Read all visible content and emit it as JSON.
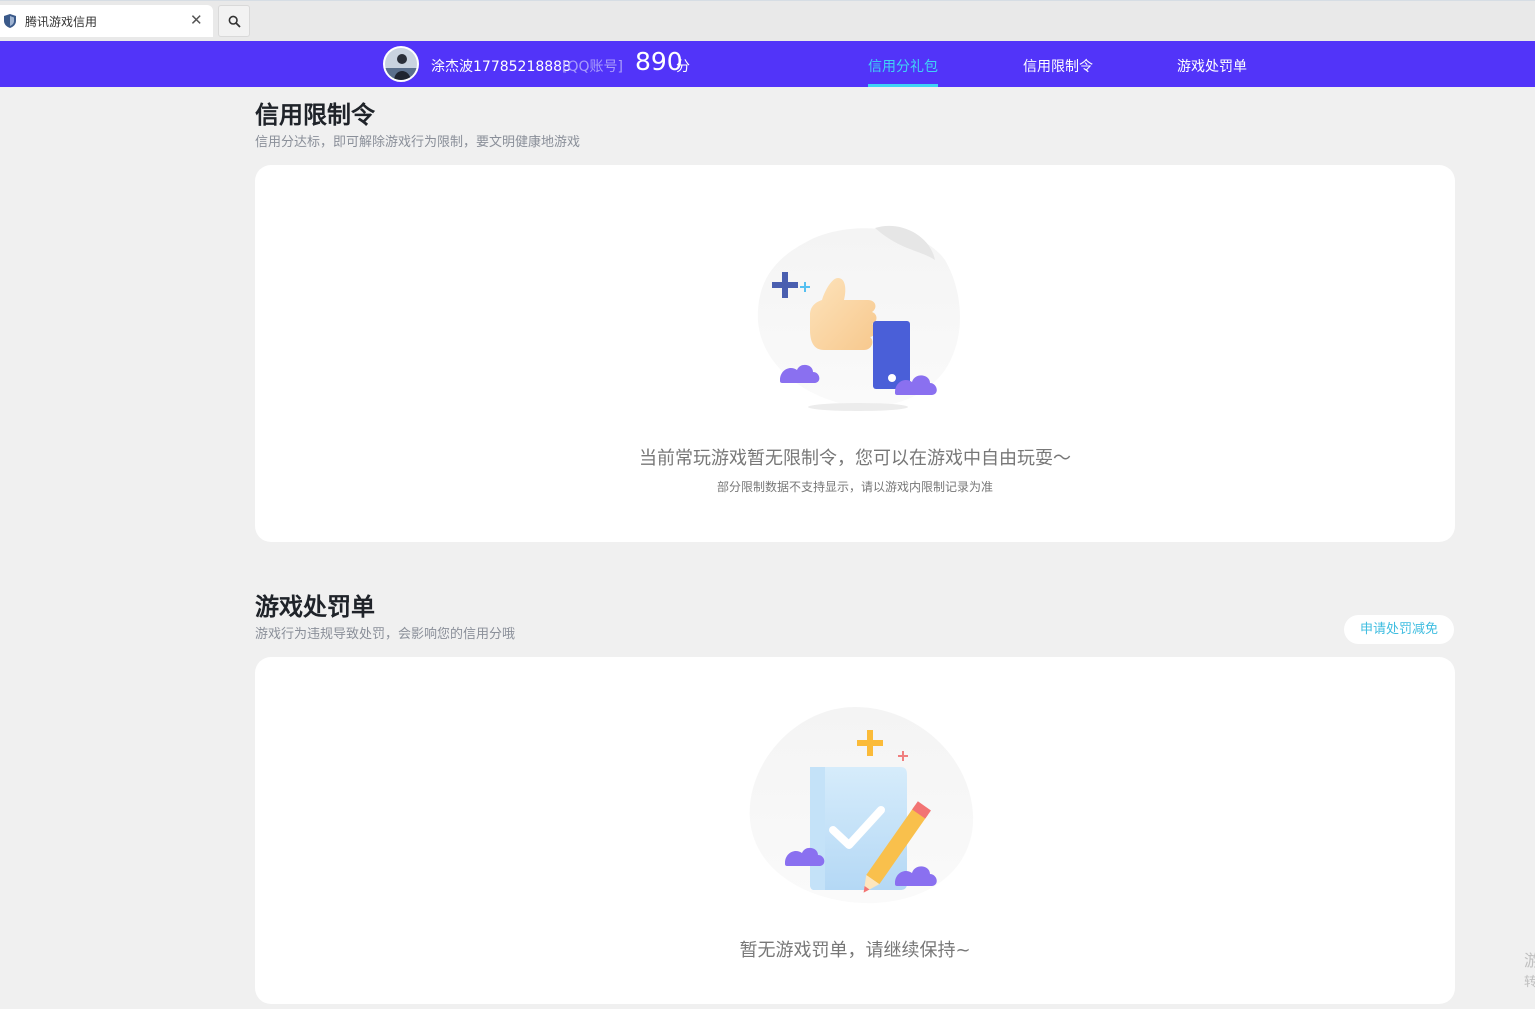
{
  "browser": {
    "tab_title": "腾讯游戏信用",
    "tab_close": "✕"
  },
  "navbar": {
    "username": "涂杰波17785218888",
    "account_type": "[QQ账号]",
    "score": "890",
    "score_unit": "分",
    "tabs": [
      {
        "label": "信用分礼包",
        "active": true
      },
      {
        "label": "信用限制令",
        "active": false
      },
      {
        "label": "游戏处罚单",
        "active": false
      }
    ],
    "brand_color": "#5234f9",
    "active_color": "#3fd3f5"
  },
  "restriction": {
    "title": "信用限制令",
    "subtitle": "信用分达标，即可解除游戏行为限制，要文明健康地游戏",
    "empty_message": "当前常玩游戏暂无限制令，您可以在游戏中自由玩耍～",
    "note": "部分限制数据不支持显示，请以游戏内限制记录为准",
    "illustration_icon": "thumbs-up-icon"
  },
  "penalty": {
    "title": "游戏处罚单",
    "subtitle": "游戏行为违规导致处罚，会影响您的信用分哦",
    "apply_button": "申请处罚减免",
    "empty_message": "暂无游戏罚单，请继续保持~",
    "illustration_icon": "clipboard-check-icon"
  },
  "edge_chars": [
    "游",
    "转"
  ]
}
